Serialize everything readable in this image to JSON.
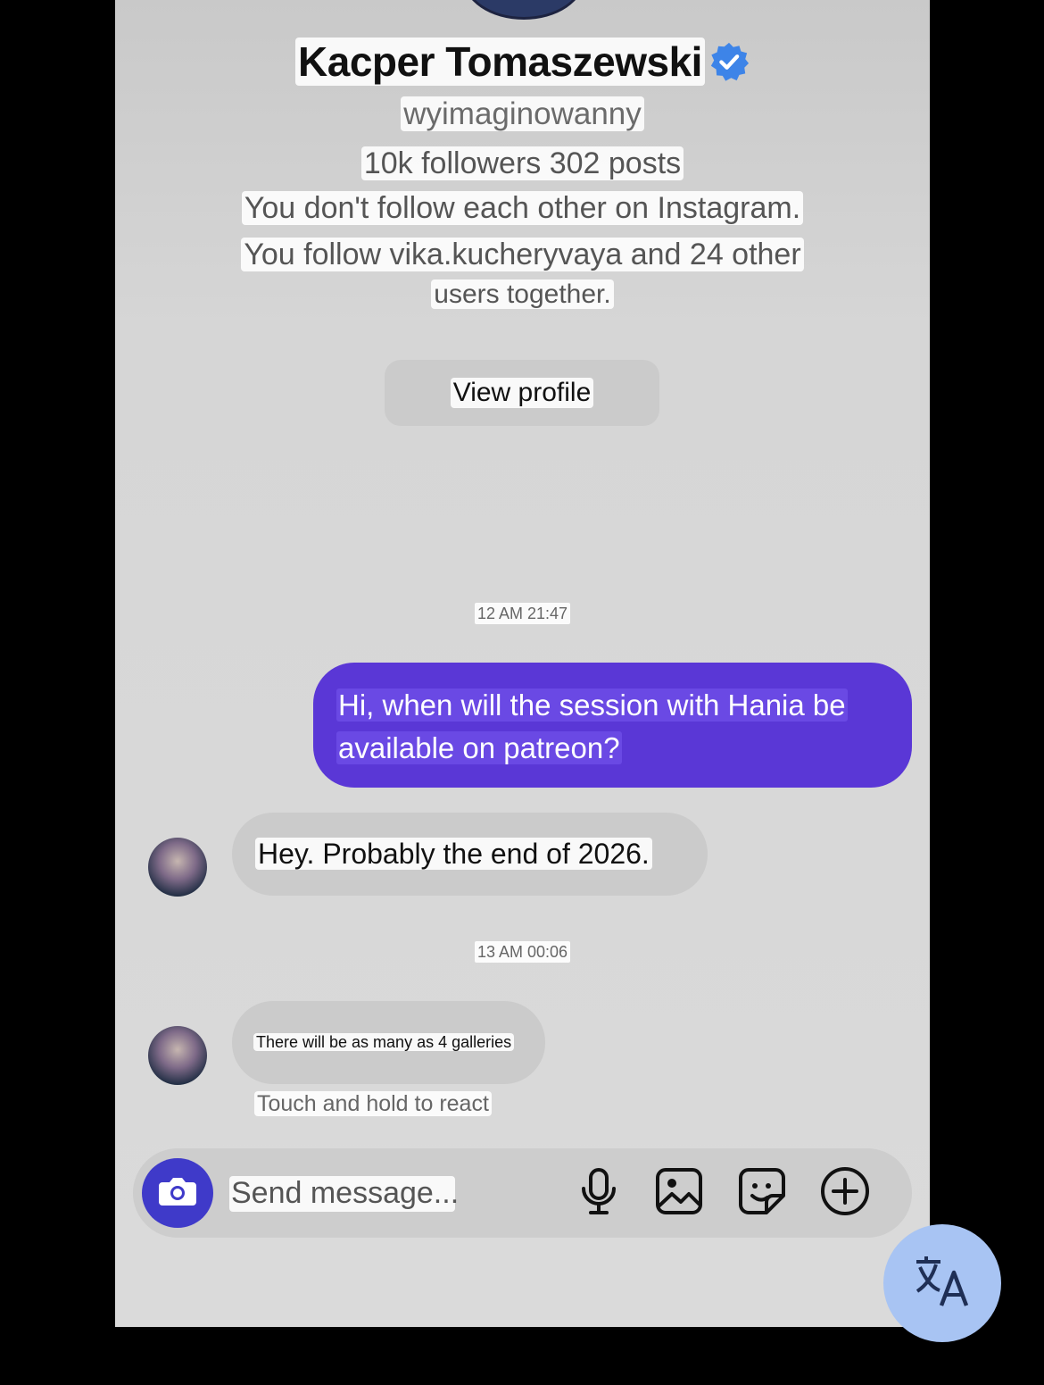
{
  "profile": {
    "name": "Kacper Tomaszewski",
    "verified_icon": "verified-badge-icon",
    "handle": "wyimaginowanny",
    "stats": "10k followers 302 posts",
    "follow_status": "You don't follow each other on Instagram.",
    "mutual_line1": "You follow vika.kucheryvaya and 24 other",
    "mutual_line2": "users together.",
    "view_profile_label": "View profile"
  },
  "messages": [
    {
      "type": "timestamp",
      "text": "12 AM 21:47"
    },
    {
      "type": "outgoing",
      "line1": "Hi, when will the session with Hania be",
      "line2": "available on patreon?"
    },
    {
      "type": "incoming",
      "text": "Hey. Probably the end of 2026."
    },
    {
      "type": "timestamp",
      "text": "13 AM 00:06"
    },
    {
      "type": "incoming",
      "text": "There will be as many as 4 galleries"
    }
  ],
  "react_hint": "Touch and hold to react",
  "composer": {
    "placeholder": "Send message...",
    "icons": [
      "camera-icon",
      "microphone-icon",
      "gallery-icon",
      "sticker-icon",
      "plus-icon"
    ]
  },
  "translate_icon": "translate-icon",
  "colors": {
    "outgoing_bubble": "#5a37d6",
    "camera_button": "#3f3ac9",
    "verified": "#3d84e8",
    "translate_fab": "#a8c4f3"
  }
}
